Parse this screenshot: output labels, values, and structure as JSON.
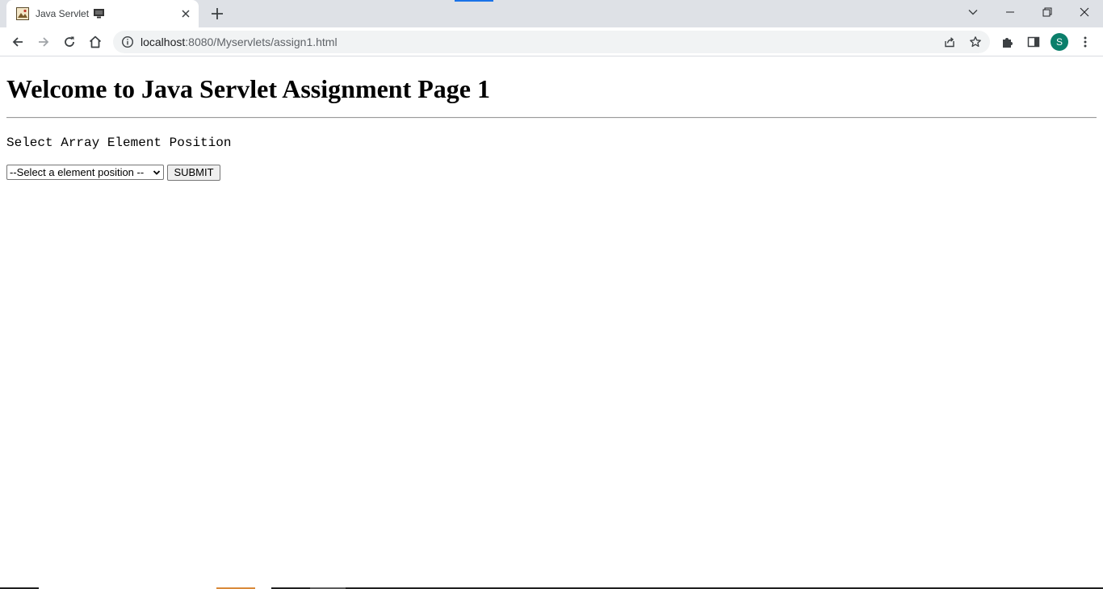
{
  "browser": {
    "tab": {
      "title": "Java Servlet",
      "favicon_icon": "image-favicon-icon",
      "title_suffix_icon": "monitor-icon",
      "close_icon": "close-icon"
    },
    "new_tab_icon": "plus-icon",
    "window_controls": [
      "tab-search-icon",
      "minimize-icon",
      "restore-icon",
      "close-window-icon"
    ],
    "address_bar": {
      "host": "localhost",
      "path": ":8080/Myservlets/assign1.html"
    },
    "profile_initial": "S",
    "accent_color": "#1a73e8",
    "avatar_color": "#0b7f6b"
  },
  "page": {
    "heading": "Welcome to Java Servlet Assignment Page 1",
    "select_label": "Select Array Element Position",
    "select_value": "--Select a element position --",
    "submit_label": "SUBMIT"
  }
}
